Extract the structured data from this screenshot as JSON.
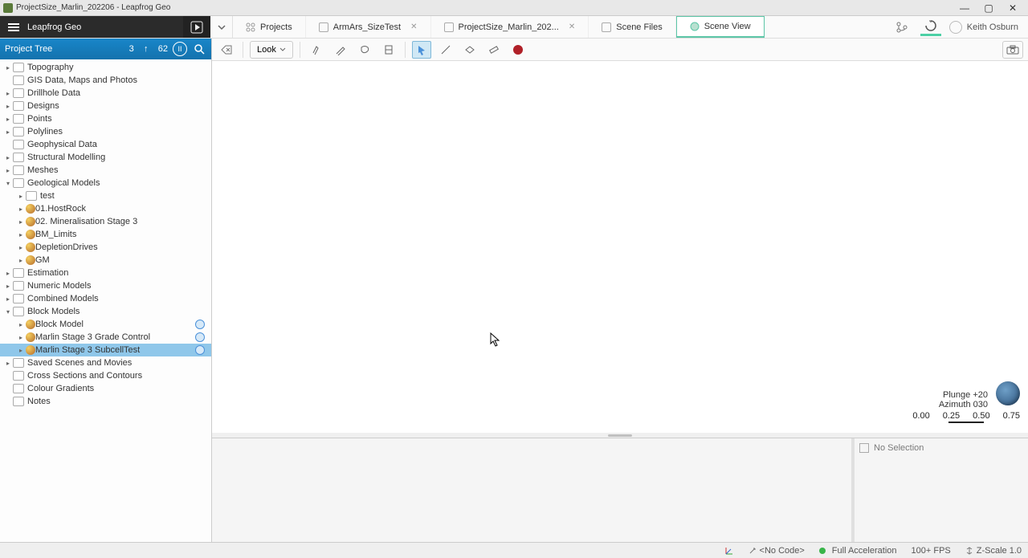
{
  "window": {
    "title": "ProjectSize_Marlin_202206 - Leapfrog Geo"
  },
  "brand": {
    "name": "Leapfrog Geo"
  },
  "tabs": [
    {
      "label": "Projects",
      "closable": false,
      "active": false
    },
    {
      "label": "ArmArs_SizeTest",
      "closable": true,
      "active": false
    },
    {
      "label": "ProjectSize_Marlin_202...",
      "closable": true,
      "active": false
    },
    {
      "label": "Scene Files",
      "closable": false,
      "active": false
    },
    {
      "label": "Scene View",
      "closable": false,
      "active": true
    }
  ],
  "user": {
    "name": "Keith Osburn"
  },
  "project_tree": {
    "title": "Project Tree",
    "counter_a": "3",
    "counter_b": "62",
    "nodes": [
      {
        "label": "Topography",
        "indent": 0,
        "chev": "▸",
        "icon": "folder"
      },
      {
        "label": "GIS Data, Maps and Photos",
        "indent": 0,
        "chev": "",
        "icon": "folder"
      },
      {
        "label": "Drillhole Data",
        "indent": 0,
        "chev": "▸",
        "icon": "folder"
      },
      {
        "label": "Designs",
        "indent": 0,
        "chev": "▸",
        "icon": "folder"
      },
      {
        "label": "Points",
        "indent": 0,
        "chev": "▸",
        "icon": "folder"
      },
      {
        "label": "Polylines",
        "indent": 0,
        "chev": "▸",
        "icon": "folder"
      },
      {
        "label": "Geophysical Data",
        "indent": 0,
        "chev": "",
        "icon": "folder"
      },
      {
        "label": "Structural Modelling",
        "indent": 0,
        "chev": "▸",
        "icon": "folder"
      },
      {
        "label": "Meshes",
        "indent": 0,
        "chev": "▸",
        "icon": "folder"
      },
      {
        "label": "Geological Models",
        "indent": 0,
        "chev": "▾",
        "icon": "folder"
      },
      {
        "label": "test",
        "indent": 1,
        "chev": "▸",
        "icon": "folder"
      },
      {
        "label": "01.HostRock",
        "indent": 1,
        "chev": "▸",
        "icon": "geo"
      },
      {
        "label": "02. Mineralisation Stage 3",
        "indent": 1,
        "chev": "▸",
        "icon": "geo"
      },
      {
        "label": "BM_Limits",
        "indent": 1,
        "chev": "▸",
        "icon": "geo"
      },
      {
        "label": "DepletionDrives",
        "indent": 1,
        "chev": "▸",
        "icon": "geo"
      },
      {
        "label": "GM",
        "indent": 1,
        "chev": "▸",
        "icon": "geo"
      },
      {
        "label": "Estimation",
        "indent": 0,
        "chev": "▸",
        "icon": "folder"
      },
      {
        "label": "Numeric Models",
        "indent": 0,
        "chev": "▸",
        "icon": "folder"
      },
      {
        "label": "Combined Models",
        "indent": 0,
        "chev": "▸",
        "icon": "folder"
      },
      {
        "label": "Block Models",
        "indent": 0,
        "chev": "▾",
        "icon": "folder"
      },
      {
        "label": "Block Model",
        "indent": 1,
        "chev": "▸",
        "icon": "geo",
        "badge": true
      },
      {
        "label": "Marlin Stage 3 Grade Control",
        "indent": 1,
        "chev": "▸",
        "icon": "geo",
        "badge": true
      },
      {
        "label": "Marlin Stage 3 SubcellTest",
        "indent": 1,
        "chev": "▸",
        "icon": "geo",
        "badge": true,
        "selected": true
      },
      {
        "label": "Saved Scenes and Movies",
        "indent": 0,
        "chev": "▸",
        "icon": "folder"
      },
      {
        "label": "Cross Sections and Contours",
        "indent": 0,
        "chev": "",
        "icon": "folder"
      },
      {
        "label": "Colour Gradients",
        "indent": 0,
        "chev": "",
        "icon": "folder"
      },
      {
        "label": "Notes",
        "indent": 0,
        "chev": "",
        "icon": "folder"
      }
    ]
  },
  "toolbar": {
    "look_label": "Look"
  },
  "orientation": {
    "plunge": "Plunge  +20",
    "azimuth": "Azimuth  030",
    "ticks": [
      "0.00",
      "0.25",
      "0.50",
      "0.75"
    ]
  },
  "selection_panel": {
    "no_selection": "No Selection"
  },
  "status": {
    "no_code": "<No Code>",
    "accel": "Full Acceleration",
    "fps": "100+ FPS",
    "zscale": "Z-Scale 1.0"
  }
}
